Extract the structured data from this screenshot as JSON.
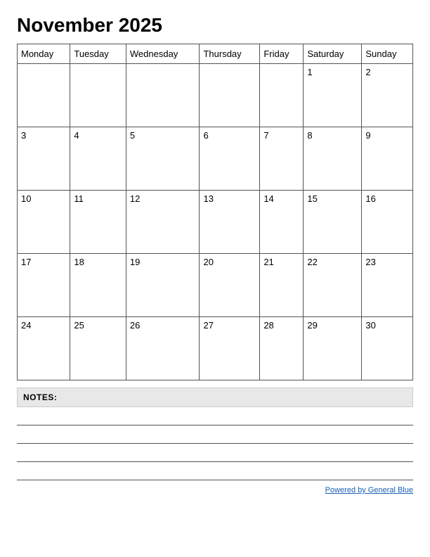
{
  "title": "November 2025",
  "days_of_week": [
    "Monday",
    "Tuesday",
    "Wednesday",
    "Thursday",
    "Friday",
    "Saturday",
    "Sunday"
  ],
  "weeks": [
    [
      null,
      null,
      null,
      null,
      null,
      1,
      2
    ],
    [
      3,
      4,
      5,
      6,
      7,
      8,
      9
    ],
    [
      10,
      11,
      12,
      13,
      14,
      15,
      16
    ],
    [
      17,
      18,
      19,
      20,
      21,
      22,
      23
    ],
    [
      24,
      25,
      26,
      27,
      28,
      29,
      30
    ]
  ],
  "notes_label": "NOTES:",
  "powered_by_text": "Powered by General Blue",
  "powered_by_url": "#"
}
